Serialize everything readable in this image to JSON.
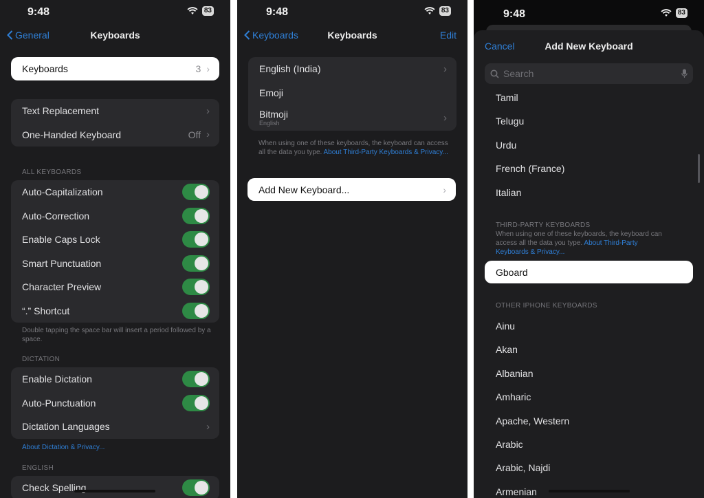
{
  "status": {
    "time": "9:48",
    "battery": "83"
  },
  "panel1": {
    "back": "General",
    "title": "Keyboards",
    "keyboards_row": {
      "label": "Keyboards",
      "value": "3"
    },
    "group1": [
      {
        "label": "Text Replacement",
        "value": ""
      },
      {
        "label": "One-Handed Keyboard",
        "value": "Off"
      }
    ],
    "all_keyboards_header": "ALL KEYBOARDS",
    "toggles": [
      "Auto-Capitalization",
      "Auto-Correction",
      "Enable Caps Lock",
      "Smart Punctuation",
      "Character Preview",
      "“.” Shortcut"
    ],
    "shortcut_footer": "Double tapping the space bar will insert a period followed by a space.",
    "dictation_header": "DICTATION",
    "dictation": {
      "enable": "Enable Dictation",
      "auto_punct": "Auto-Punctuation",
      "languages": "Dictation Languages"
    },
    "dictation_link": "About Dictation & Privacy...",
    "english_header": "ENGLISH",
    "check_spelling": "Check Spelling"
  },
  "panel2": {
    "back": "Keyboards",
    "title": "Keyboards",
    "edit": "Edit",
    "keyboards": [
      {
        "label": "English (India)",
        "sub": ""
      },
      {
        "label": "Emoji",
        "sub": ""
      },
      {
        "label": "Bitmoji",
        "sub": "English"
      }
    ],
    "footer_text": "When using one of these keyboards, the keyboard can access all the data you type. ",
    "footer_link": "About Third-Party Keyboards & Privacy...",
    "add_keyboard": "Add New Keyboard..."
  },
  "panel3": {
    "cancel": "Cancel",
    "title": "Add New Keyboard",
    "search_placeholder": "Search",
    "top_languages": [
      "Tamil",
      "Telugu",
      "Urdu",
      "French (France)",
      "Italian"
    ],
    "third_party_header": "THIRD-PARTY KEYBOARDS",
    "third_party_text": "When using one of these keyboards, the keyboard can access all the data you type. ",
    "third_party_link": "About Third-Party Keyboards & Privacy...",
    "gboard": "Gboard",
    "other_header": "OTHER IPHONE KEYBOARDS",
    "other_languages": [
      "Ainu",
      "Akan",
      "Albanian",
      "Amharic",
      "Apache, Western",
      "Arabic",
      "Arabic, Najdi",
      "Armenian"
    ]
  },
  "colors": {
    "accent": "#2f7fd6",
    "toggle_on": "#2e8a45",
    "highlight": "#ffffff"
  }
}
